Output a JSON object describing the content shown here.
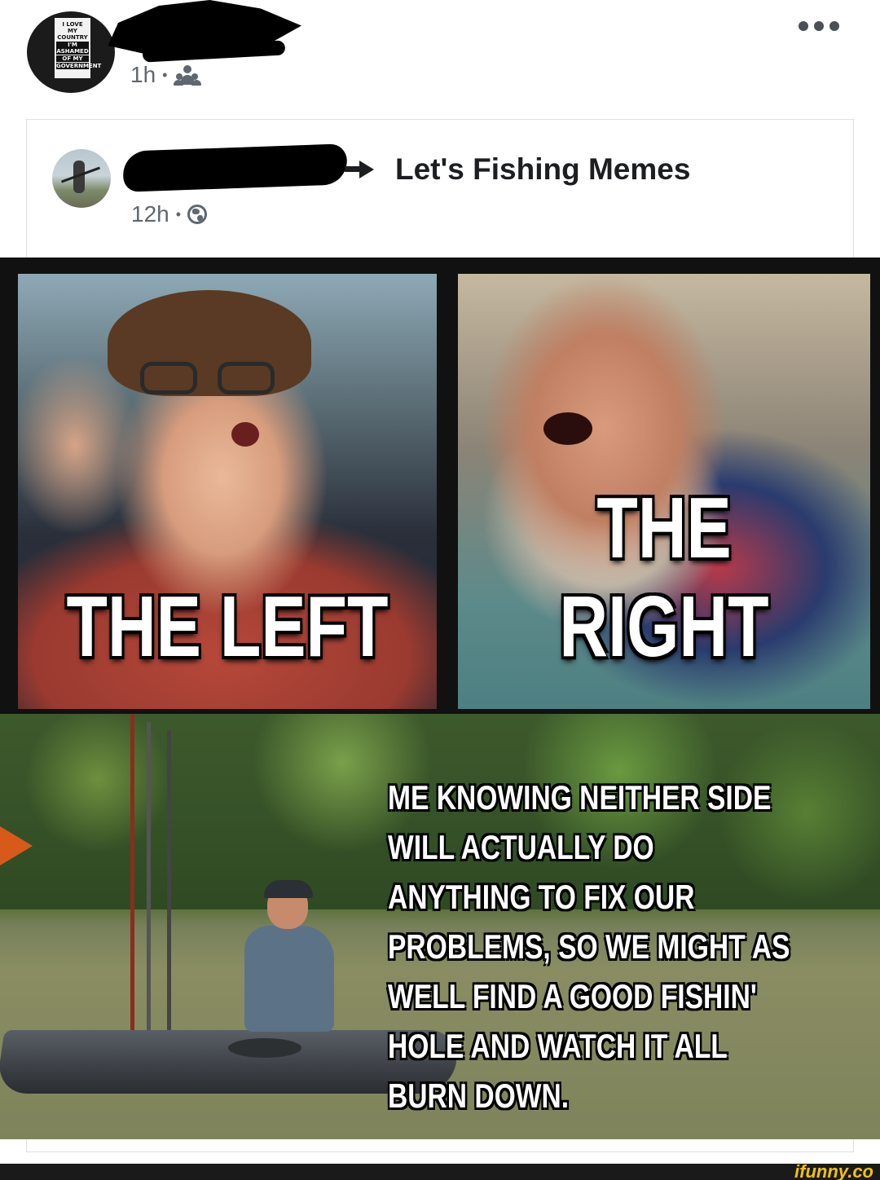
{
  "outer_post": {
    "time": "1h",
    "audience_icon": "friends-icon",
    "more_icon": "more-dots-icon"
  },
  "shared_post": {
    "group_name": "Let's Fishing Memes",
    "time": "12h",
    "audience_icon": "globe-icon"
  },
  "meme": {
    "left_caption": "THE LEFT",
    "right_caption": "THE RIGHT",
    "bottom_caption": "ME KNOWING NEITHER SIDE WILL ACTUALLY DO ANYTHING TO FIX OUR PROBLEMS, SO WE MIGHT AS WELL FIND A GOOD FISHIN' HOLE AND WATCH IT ALL BURN DOWN."
  },
  "watermark": "ifunny.co",
  "avatar_sign_text": [
    "I LOVE",
    "MY",
    "COUNTRY",
    "I'M ASHAMED",
    "OF MY",
    "GOVERNMENT"
  ]
}
